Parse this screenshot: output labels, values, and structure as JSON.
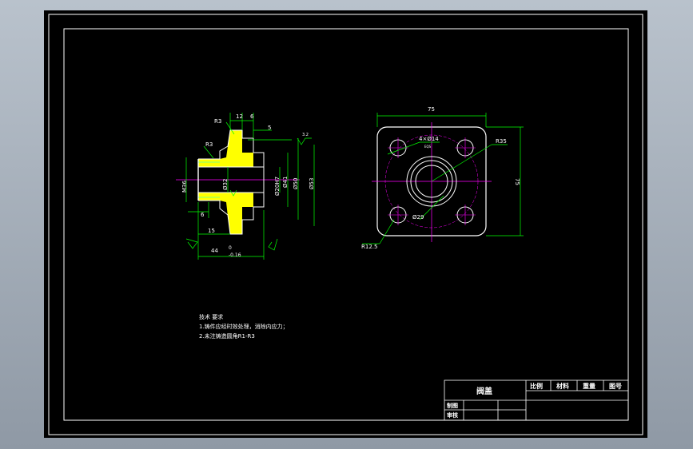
{
  "drawing": {
    "dims": {
      "d12": "12",
      "d6": "6",
      "d5": "5",
      "r3a": "R3",
      "r3b": "R3",
      "m36": "M36",
      "d32": "Ø32",
      "d20h7": "Ø20H7",
      "d41": "Ø41",
      "d50": "Ø50",
      "d53": "Ø53",
      "d6b": "6",
      "d15": "15",
      "d44_base": "44",
      "d44_upper": "0",
      "d44_lower": "-0.16",
      "ra_small": "3.2",
      "d75_top": "75",
      "d75_side": "75",
      "holes": "4×Ø14",
      "eqs": "EQS",
      "d29": "Ø29",
      "r35": "R35",
      "r125": "R12.5"
    },
    "notes": {
      "title": "技术 要求",
      "line1": "1.铸件应经时效处理，消除内应力；",
      "line2": "2.未注铸造圆角R1-R3"
    }
  },
  "title_block": {
    "part_name": "阀盖",
    "h_scale": "比例",
    "h_material": "材料",
    "h_weight": "重量",
    "h_drawing_no": "图号",
    "drawn": "制图",
    "checked": "审核"
  },
  "colors": {
    "outline": "#ffffff",
    "dimension": "#00ff00",
    "center": "#ff00ff",
    "hatch": "#ffff00",
    "section": "#00ffff"
  }
}
